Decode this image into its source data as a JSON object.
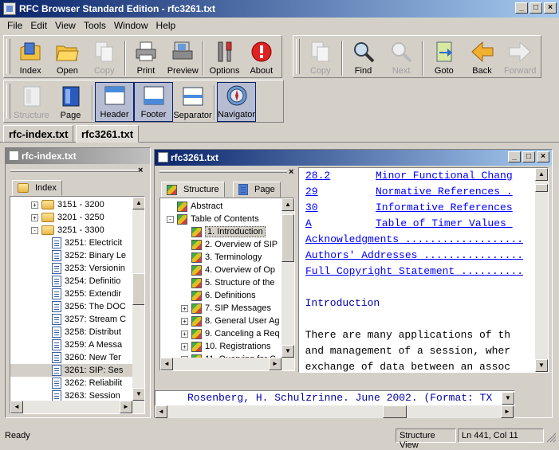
{
  "window": {
    "title": "RFC Browser Standard Edition - rfc3261.txt",
    "min": "_",
    "max": "□",
    "close": "×"
  },
  "menu": [
    "File",
    "Edit",
    "View",
    "Tools",
    "Window",
    "Help"
  ],
  "toolbar1": [
    {
      "label": "Index",
      "icon": "index-icon",
      "enabled": true
    },
    {
      "label": "Open",
      "icon": "open-folder-icon",
      "enabled": true
    },
    {
      "label": "Copy",
      "icon": "copy-icon",
      "enabled": false
    },
    {
      "label": "Print",
      "icon": "printer-icon",
      "enabled": true
    },
    {
      "label": "Preview",
      "icon": "print-preview-icon",
      "enabled": true
    },
    {
      "label": "Options",
      "icon": "options-tools-icon",
      "enabled": true
    },
    {
      "label": "About",
      "icon": "about-info-icon",
      "enabled": true
    }
  ],
  "toolbar2": [
    {
      "label": "Copy",
      "icon": "copy-icon",
      "enabled": false
    },
    {
      "label": "Find",
      "icon": "magnifier-icon",
      "enabled": true
    },
    {
      "label": "Next",
      "icon": "find-next-icon",
      "enabled": false
    },
    {
      "label": "Goto",
      "icon": "goto-icon",
      "enabled": true
    },
    {
      "label": "Back",
      "icon": "back-arrow-icon",
      "enabled": true
    },
    {
      "label": "Forward",
      "icon": "forward-arrow-icon",
      "enabled": false
    }
  ],
  "toolbar3": [
    {
      "label": "Structure",
      "icon": "structure-icon",
      "enabled": false,
      "pressed": false
    },
    {
      "label": "Page",
      "icon": "page-icon",
      "enabled": true,
      "pressed": false
    },
    {
      "label": "Header",
      "icon": "header-icon",
      "enabled": true,
      "pressed": true
    },
    {
      "label": "Footer",
      "icon": "footer-icon",
      "enabled": true,
      "pressed": true
    },
    {
      "label": "Separator",
      "icon": "separator-icon",
      "enabled": true,
      "pressed": false
    },
    {
      "label": "Navigator",
      "icon": "compass-icon",
      "enabled": true,
      "pressed": true
    }
  ],
  "doc_tabs": [
    "rfc-index.txt",
    "rfc3261.txt"
  ],
  "index_panel": {
    "title": "rfc-index.txt",
    "tab": "Index",
    "close": "×",
    "folders": [
      {
        "label": "3151 - 3200",
        "expanded": false
      },
      {
        "label": "3201 - 3250",
        "expanded": false
      },
      {
        "label": "3251 - 3300",
        "expanded": true
      }
    ],
    "items": [
      "3251: Electricit",
      "3252: Binary Le",
      "3253: Versionin",
      "3254: Definitio",
      "3255: Extendir",
      "3256: The DOC",
      "3257: Stream C",
      "3258: Distribut",
      "3259: A Messa",
      "3260: New Ter",
      "3261: SIP: Ses",
      "3262: Reliabilit",
      "3263: Session"
    ],
    "selected_index": 10
  },
  "doc_window": {
    "title": "rfc3261.txt",
    "nav_tabs": [
      "Structure",
      "Page"
    ],
    "nav_close": "×",
    "tree": [
      {
        "label": "Abstract",
        "expander": ""
      },
      {
        "label": "Table of Contents",
        "expander": "-"
      },
      {
        "label": "1. Introduction",
        "expander": "",
        "child": true,
        "selected": true
      },
      {
        "label": "2. Overview of SIP",
        "expander": "",
        "child": true
      },
      {
        "label": "3. Terminology",
        "expander": "",
        "child": true
      },
      {
        "label": "4. Overview of Op",
        "expander": "",
        "child": true
      },
      {
        "label": "5. Structure of the",
        "expander": "",
        "child": true
      },
      {
        "label": "6. Definitions",
        "expander": "",
        "child": true
      },
      {
        "label": "7. SIP Messages",
        "expander": "+",
        "child": true
      },
      {
        "label": "8. General User Ag",
        "expander": "+",
        "child": true
      },
      {
        "label": "9. Canceling a Req",
        "expander": "+",
        "child": true
      },
      {
        "label": "10. Registrations",
        "expander": "+",
        "child": true
      },
      {
        "label": "11. Querying for C",
        "expander": "+",
        "child": true
      }
    ],
    "text_lines": [
      {
        "num": "28.2",
        "text": "Minor Functional Chang",
        "link": true
      },
      {
        "num": "29",
        "text": "Normative References .",
        "link": true
      },
      {
        "num": "30",
        "text": "Informative References",
        "link": true
      },
      {
        "num": "A",
        "text": "Table of Timer Values ",
        "link": true
      },
      {
        "num": "",
        "text": "Acknowledgments ...................",
        "link": true
      },
      {
        "num": "",
        "text": "Authors' Addresses ................",
        "link": true
      },
      {
        "num": "",
        "text": "Full Copyright Statement ..........",
        "link": true
      },
      {
        "num": "",
        "text": "",
        "link": false
      },
      {
        "num": "",
        "text": "1 Introduction",
        "link": false,
        "heading": true
      },
      {
        "num": "",
        "text": "",
        "link": false
      },
      {
        "num": "",
        "text": "  There are many applications of th",
        "link": false
      },
      {
        "num": "",
        "text": "  and management of a session, wher",
        "link": false
      },
      {
        "num": "",
        "text": "  exchange of data between an assoc",
        "link": false
      }
    ],
    "footer_text": "Rosenberg, H. Schulzrinne. June 2002. (Format: TX"
  },
  "status": {
    "ready": "Ready",
    "view": "Structure View",
    "position": "Ln 441, Col 11"
  }
}
